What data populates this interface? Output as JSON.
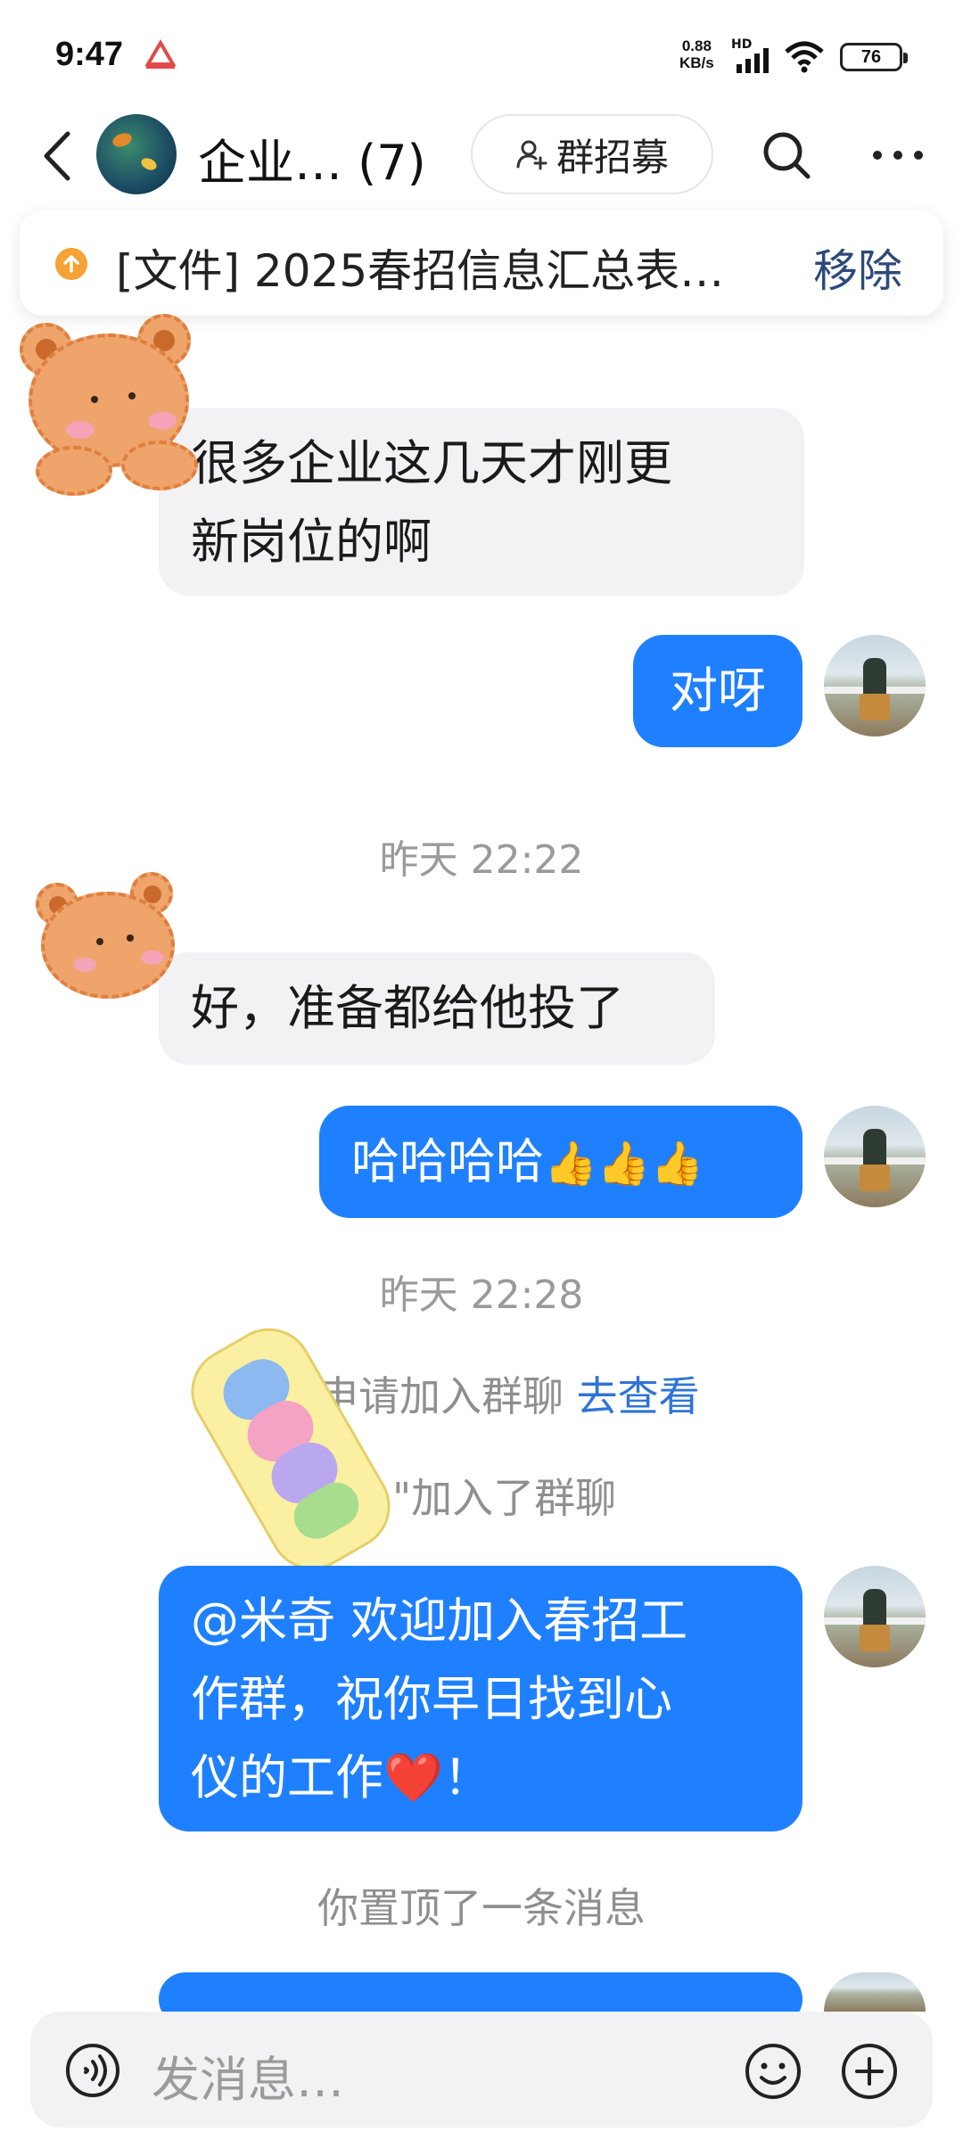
{
  "status_bar": {
    "time": "9:47",
    "net_speed_value": "0.88",
    "net_speed_unit": "KB/s",
    "hd": "HD",
    "battery": "76"
  },
  "header": {
    "group_name": "企业… (7)",
    "recruit_label": "群招募",
    "icons": [
      "back-icon",
      "search-icon",
      "more-icon",
      "add-person-icon"
    ]
  },
  "pinned": {
    "text": "[文件] 2025春招信息汇总表…",
    "remove_label": "移除"
  },
  "messages": [
    {
      "side": "left",
      "text_lines": [
        "很多企业这几天才刚更",
        "新岗位的啊"
      ]
    },
    {
      "side": "right",
      "text": "对呀"
    },
    {
      "type": "time",
      "text": "昨天 22:22"
    },
    {
      "side": "left",
      "text": "好，准备都给他投了"
    },
    {
      "side": "right",
      "text": "哈哈哈哈",
      "emoji": "👍👍👍"
    },
    {
      "type": "time",
      "text": "昨天 22:28"
    },
    {
      "type": "system",
      "text": "申请加入群聊",
      "link": "去查看"
    },
    {
      "type": "system",
      "text": "\"加入了群聊"
    },
    {
      "side": "right",
      "text_lines": [
        "@米奇  欢迎加入春招工",
        "作群，祝你早日找到心",
        "仪的工作❤️！"
      ]
    },
    {
      "type": "system",
      "text": "你置顶了一条消息"
    }
  ],
  "input": {
    "placeholder": "发消息…"
  },
  "colors": {
    "bubble_self": "#1f80ff",
    "bubble_other": "#f2f2f4",
    "link": "#2f74d6"
  }
}
